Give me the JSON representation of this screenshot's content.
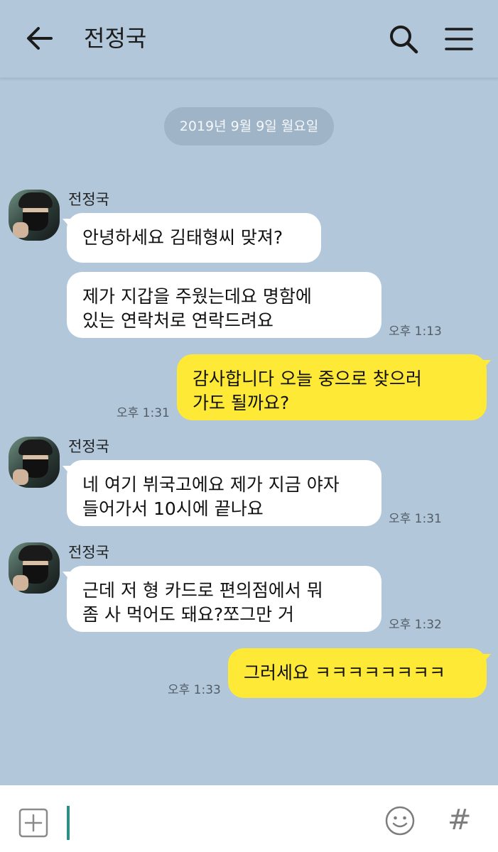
{
  "header": {
    "title": "전정국",
    "back_icon": "back-arrow-icon",
    "search_icon": "search-icon",
    "menu_icon": "hamburger-menu-icon"
  },
  "date_divider": "2019년 9월 9일 월요일",
  "messages": [
    {
      "sender": "전정국",
      "direction": "incoming",
      "text": "안녕하세요 김태형씨 맞져?",
      "time": ""
    },
    {
      "sender": "",
      "direction": "incoming",
      "text": "제가 지갑을 주웠는데요 명함에\n있는 연락처로 연락드려요",
      "time": "오후 1:13"
    },
    {
      "sender": "",
      "direction": "outgoing",
      "text": "감사합니다 오늘 중으로 찾으러\n가도 될까요?",
      "time": "오후 1:31"
    },
    {
      "sender": "전정국",
      "direction": "incoming",
      "text": "네 여기 뷔국고에요 제가 지금 야자\n들어가서 10시에 끝나요",
      "time": "오후 1:31"
    },
    {
      "sender": "전정국",
      "direction": "incoming",
      "text": "근데 저 형 카드로 편의점에서 뭐\n좀 사 먹어도 돼요?쪼그만 거",
      "time": "오후 1:32"
    },
    {
      "sender": "",
      "direction": "outgoing",
      "text": "그러세요 ㅋㅋㅋㅋㅋㅋㅋㅋ",
      "time": "오후 1:33"
    }
  ],
  "input_bar": {
    "add_icon": "plus-square-icon",
    "emoji_icon": "smiley-icon",
    "hash_symbol": "#"
  },
  "colors": {
    "background": "#b2c7da",
    "incoming_bubble": "#ffffff",
    "outgoing_bubble": "#fee936",
    "cursor": "#2a8f88"
  }
}
